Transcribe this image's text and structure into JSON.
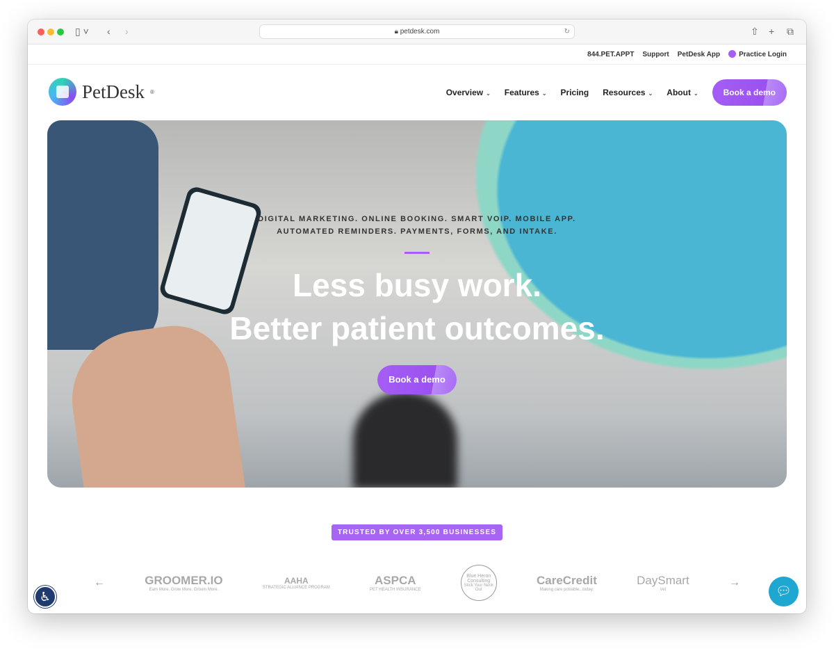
{
  "browser": {
    "url": "petdesk.com"
  },
  "topbar": {
    "phone": "844.PET.APPT",
    "support": "Support",
    "app": "PetDesk App",
    "login": "Practice Login"
  },
  "nav": {
    "logo": "PetDesk",
    "logo_mark": "®",
    "items": [
      {
        "label": "Overview",
        "dropdown": true
      },
      {
        "label": "Features",
        "dropdown": true
      },
      {
        "label": "Pricing",
        "dropdown": false
      },
      {
        "label": "Resources",
        "dropdown": true
      },
      {
        "label": "About",
        "dropdown": true
      }
    ],
    "cta": "Book a demo"
  },
  "hero": {
    "eyebrow_line1": "DIGITAL MARKETING. ONLINE BOOKING. SMART VOIP. MOBILE APP.",
    "eyebrow_line2": "AUTOMATED REMINDERS. PAYMENTS, FORMS, AND INTAKE.",
    "headline_line1": "Less busy work.",
    "headline_line2": "Better patient outcomes.",
    "cta": "Book a demo"
  },
  "trusted": {
    "badge": "TRUSTED BY OVER 3,500 BUSINESSES",
    "logos": [
      {
        "name": "GROOMER.IO",
        "tagline": "Earn More. Grow More. Groom More."
      },
      {
        "name": "AAHA",
        "tagline": "STRATEGIC ALLIANCE PROGRAM"
      },
      {
        "name": "ASPCA",
        "tagline": "PET HEALTH INSURANCE"
      },
      {
        "name": "Blue Heron Consulting",
        "tagline": "Stick Your Neck Out"
      },
      {
        "name": "CareCredit",
        "tagline": "Making care possible...today."
      },
      {
        "name": "DaySmart",
        "tagline": "Vet"
      }
    ]
  },
  "colors": {
    "accent": "#a55ef5",
    "chat": "#1ea7d0",
    "access": "#1e3a6e"
  }
}
